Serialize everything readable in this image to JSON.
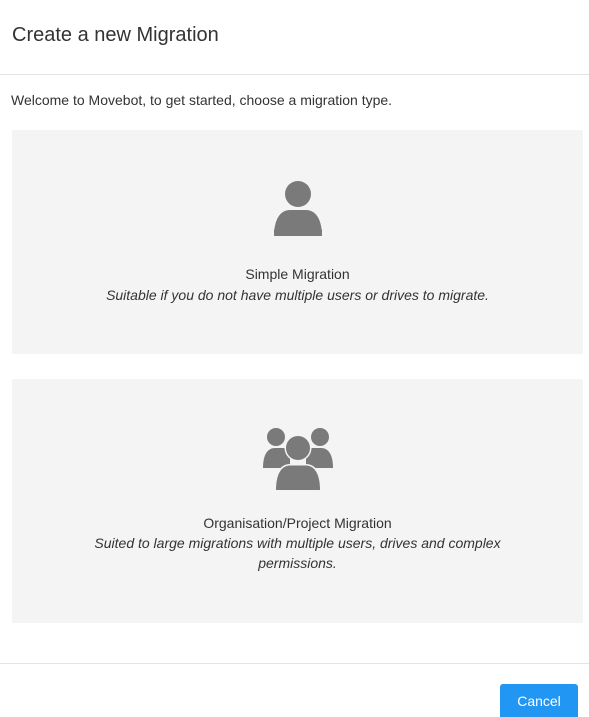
{
  "dialog": {
    "title": "Create a new Migration",
    "intro": "Welcome to Movebot, to get started, choose a migration type."
  },
  "options": [
    {
      "icon": "user-icon",
      "title": "Simple Migration",
      "description": "Suitable if you do not have multiple users or drives to migrate."
    },
    {
      "icon": "users-group-icon",
      "title": "Organisation/Project Migration",
      "description": "Suited to large migrations with multiple users, drives and complex permissions."
    }
  ],
  "footer": {
    "cancel_label": "Cancel"
  },
  "colors": {
    "primary_button": "#2196f3",
    "card_background": "#f4f4f4",
    "icon": "#7a7a7a",
    "text": "#333333",
    "divider": "#e3e3e3"
  }
}
